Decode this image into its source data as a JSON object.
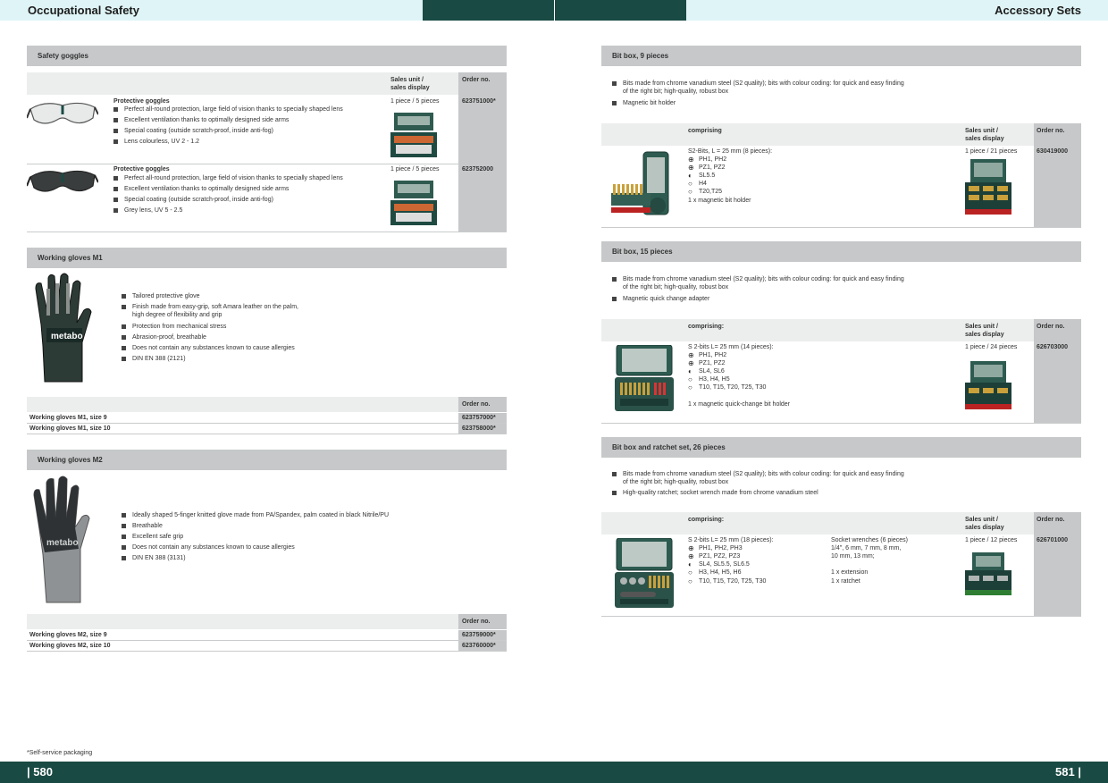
{
  "header": {
    "left_title": "Occupational Safety",
    "right_title": "Accessory Sets"
  },
  "footer": {
    "left_page": "| 580",
    "right_page": "581 |",
    "footnote": "*Self-service packaging"
  },
  "goggles": {
    "title": "Safety goggles",
    "col_sales": "Sales unit /",
    "col_sales2": "sales display",
    "col_order": "Order no.",
    "items": [
      {
        "name": "Protective goggles",
        "bullets": [
          "Perfect all-round protection, large field of vision thanks to specially shaped lens",
          "Excellent ventilation thanks to optimally designed side arms",
          "Special coating (outside scratch-proof, inside anti-fog)",
          "Lens colourless, UV 2 - 1.2"
        ],
        "sales": "1 piece / 5 pieces",
        "order": "623751000*"
      },
      {
        "name": "Protective goggles",
        "bullets": [
          "Perfect all-round protection, large field of vision thanks to specially shaped lens",
          "Excellent ventilation thanks to optimally designed side arms",
          "Special coating (outside scratch-proof, inside anti-fog)",
          "Grey lens, UV 5 - 2.5"
        ],
        "sales": "1 piece / 5 pieces",
        "order": "623752000"
      }
    ]
  },
  "gloves_m1": {
    "title": "Working gloves M1",
    "logo": "metabo",
    "bullets": [
      "Tailored protective glove",
      "Finish made from easy-grip, soft Amara leather on the palm,",
      "Protection from mechanical stress",
      "Abrasion-proof, breathable",
      "Does not contain any substances known to cause allergies",
      "DIN EN 388 (2121)"
    ],
    "bullet2_cont": "high degree of flexibility and grip",
    "col_order": "Order no.",
    "rows": [
      {
        "name": "Working gloves M1, size 9",
        "order": "623757000*"
      },
      {
        "name": "Working gloves M1, size 10",
        "order": "623758000*"
      }
    ]
  },
  "gloves_m2": {
    "title": "Working gloves M2",
    "logo": "metabo",
    "bullets": [
      "Ideally shaped 5-finger knitted glove made from PA/Spandex, palm coated in black Nitrile/PU",
      "Breathable",
      "Excellent safe grip",
      "Does not contain any substances known to cause allergies",
      "DIN EN 388 (3131)"
    ],
    "col_order": "Order no.",
    "rows": [
      {
        "name": "Working gloves M2, size 9",
        "order": "623759000*"
      },
      {
        "name": "Working gloves M2, size 10",
        "order": "623760000*"
      }
    ]
  },
  "bitbox9": {
    "title": "Bit box, 9 pieces",
    "bullet1a": "Bits made from chrome vanadium steel (S2 quality); bits with colour coding: for quick and easy finding",
    "bullet1b": "of the right bit; high-quality, robust box",
    "bullet2": "Magnetic bit holder",
    "col_comprising": "comprising",
    "col_sales": "Sales unit /",
    "col_sales2": "sales display",
    "col_order": "Order no.",
    "content_head": "S2-Bits, L = 25 mm (8 pieces):",
    "lines": [
      "PH1, PH2",
      "PZ1, PZ2",
      "SL5.5",
      "H4",
      "T20,T25"
    ],
    "extra": "1 x magnetic bit holder",
    "sales": "1 piece / 21 pieces",
    "order": "630419000"
  },
  "bitbox15": {
    "title": "Bit box, 15 pieces",
    "bullet1a": "Bits made from chrome vanadium steel (S2 quality); bits with colour coding: for quick and easy finding",
    "bullet1b": "of the right bit; high-quality, robust box",
    "bullet2": "Magnetic quick change adapter",
    "col_comprising": "comprising:",
    "col_sales": "Sales unit /",
    "col_sales2": "sales display",
    "col_order": "Order no.",
    "content_head": "S 2-bits L= 25 mm (14 pieces):",
    "lines": [
      "PH1, PH2",
      "PZ1, PZ2",
      "SL4, SL6",
      "H3, H4, H5",
      "T10, T15, T20, T25, T30"
    ],
    "extra": "1 x magnetic quick-change bit holder",
    "sales": "1 piece / 24 pieces",
    "order": "626703000"
  },
  "ratchet": {
    "title": "Bit box and ratchet set, 26 pieces",
    "bullet1a": "Bits made from chrome vanadium steel (S2 quality); bits with colour coding: for quick and easy finding",
    "bullet1b": "of the right bit; high-quality, robust box",
    "bullet2": "High-quality ratchet; socket wrench made from chrome vanadium steel",
    "col_comprising": "comprising:",
    "col_sales": "Sales unit /",
    "col_sales2": "sales display",
    "col_order": "Order no.",
    "content_head": "S 2-bits L= 25 mm (18 pieces):",
    "lines": [
      "PH1, PH2, PH3",
      "PZ1, PZ2, PZ3",
      "SL4, SL5.5, SL6.5",
      "H3, H4, H5, H6",
      "T10, T15, T20, T25, T30"
    ],
    "sockets_head": "Socket wrenches (6 pieces)",
    "sockets_1": "1/4\", 6 mm, 7 mm, 8 mm,",
    "sockets_2": "10 mm, 13 mm;",
    "sockets_ext": "1 x extension",
    "sockets_rat": "1 x ratchet",
    "sales": "1 piece / 12 pieces",
    "order": "626701000"
  },
  "colors": {
    "dark_green": "#1a4a44",
    "light_cyan": "#dff4f6",
    "grey_bar": "#c6c8c9"
  }
}
